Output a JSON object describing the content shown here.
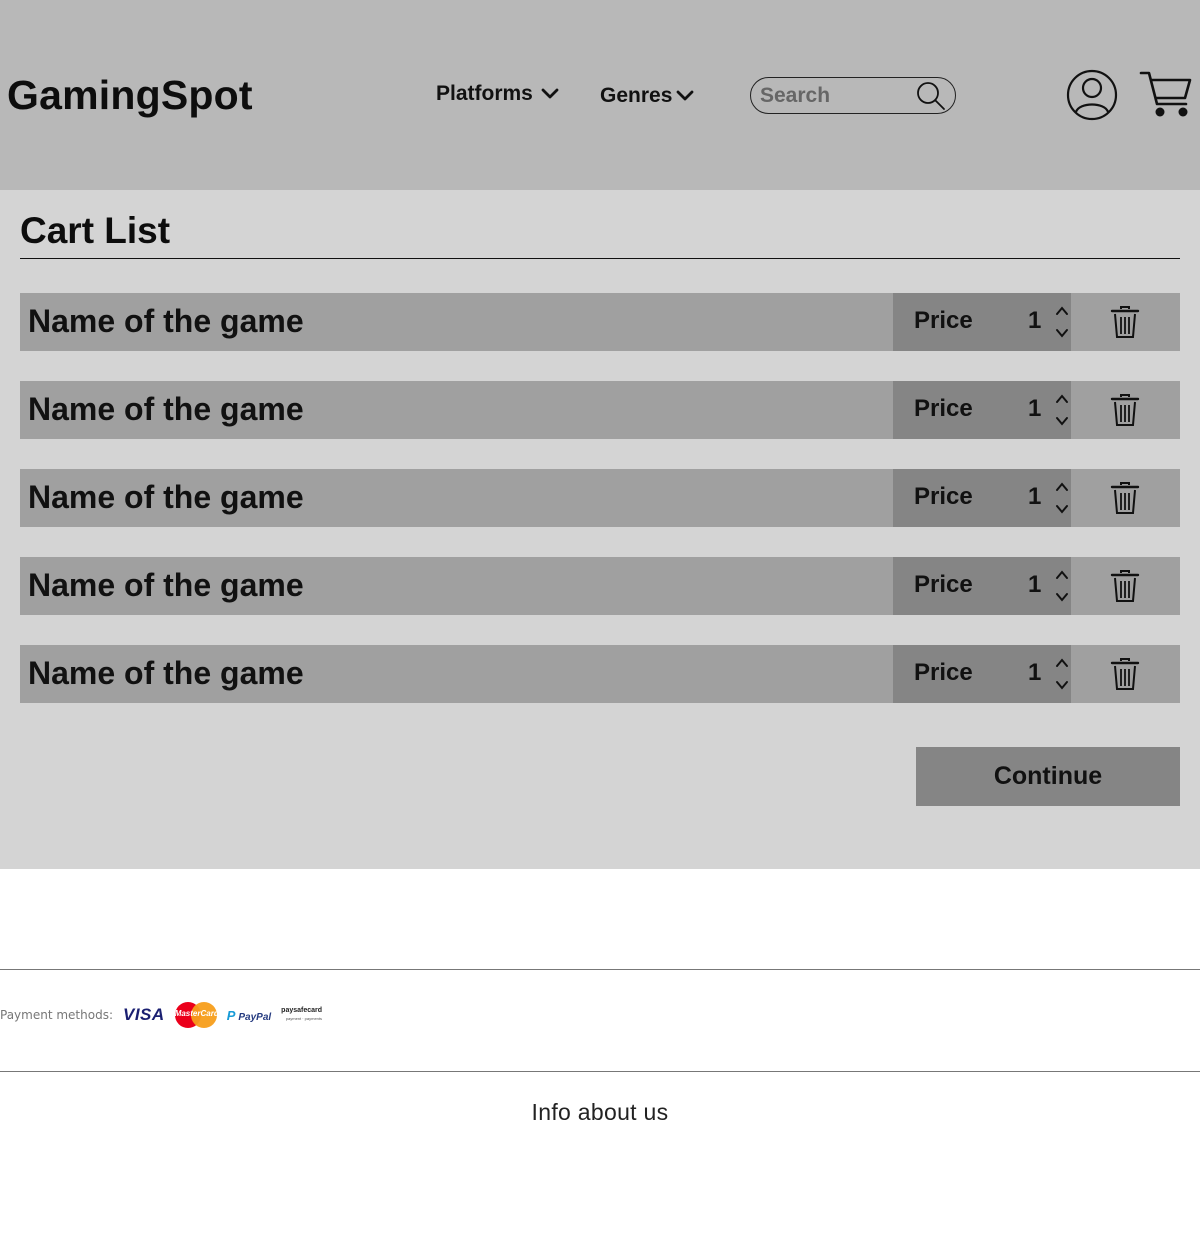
{
  "header": {
    "brand": "GamingSpot",
    "nav": [
      {
        "label": "Platforms"
      },
      {
        "label": "Genres"
      }
    ],
    "search": {
      "placeholder": "Search",
      "value": ""
    },
    "icons": {
      "search": "search-icon",
      "account": "user-icon",
      "cart": "cart-icon",
      "dropdown": "chevron-down-icon"
    }
  },
  "cart": {
    "title": "Cart List",
    "items": [
      {
        "name": "Name of the game",
        "price_label": "Price",
        "quantity": "1"
      },
      {
        "name": "Name of the game",
        "price_label": "Price",
        "quantity": "1"
      },
      {
        "name": "Name of the game",
        "price_label": "Price",
        "quantity": "1"
      },
      {
        "name": "Name of the game",
        "price_label": "Price",
        "quantity": "1"
      },
      {
        "name": "Name of the game",
        "price_label": "Price",
        "quantity": "1"
      }
    ],
    "continue_label": "Continue"
  },
  "footer": {
    "payment_label": "Payment methods:",
    "payment_methods": [
      "VISA",
      "MasterCard",
      "PayPal",
      "paysafecard"
    ],
    "info": "Info about us"
  },
  "colors": {
    "header_bg": "#b8b8b8",
    "main_bg": "#d4d4d4",
    "row_bg": "#a0a0a0",
    "price_bg": "#858585",
    "button_bg": "#858585"
  }
}
